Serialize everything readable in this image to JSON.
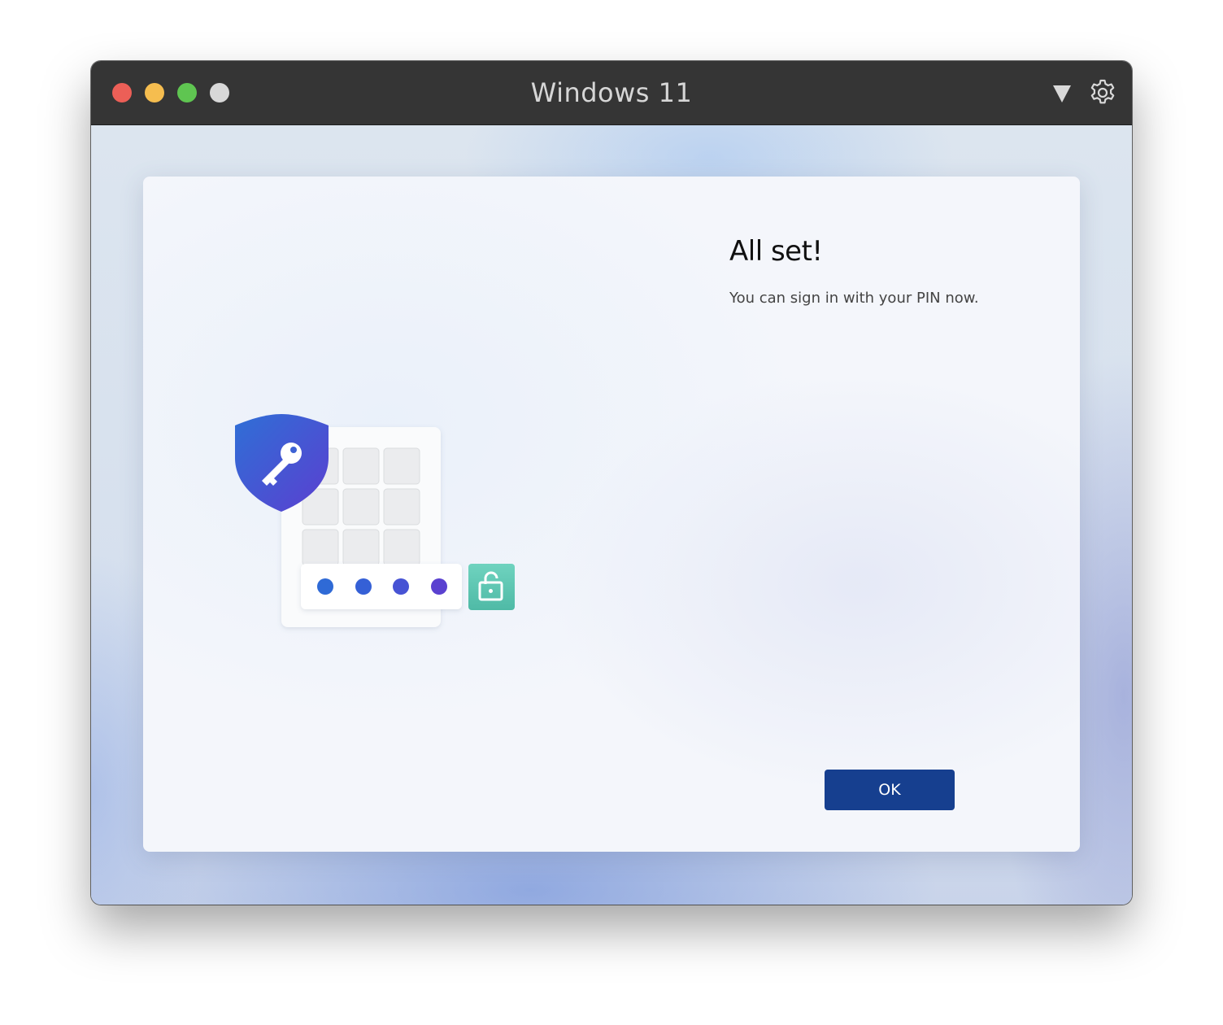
{
  "window": {
    "title": "Windows 11"
  },
  "setup": {
    "heading": "All set!",
    "message": "You can sign in with your PIN now.",
    "ok_label": "OK"
  },
  "colors": {
    "titlebar": "#353535",
    "accent_button": "#163f8f",
    "traffic_close": "#ec5f57",
    "traffic_minimize": "#f5bd4f",
    "traffic_maximize": "#5fc551",
    "shield_blue": "#2f6fd6",
    "unlock_teal": "#5cc7b2"
  },
  "icons": {
    "titlebar": [
      "dropdown-triangle-icon",
      "gear-icon"
    ],
    "bottom": [
      "accessibility-icon",
      "volume-icon"
    ],
    "illustration": [
      "shield-key-icon",
      "keypad-icon",
      "pin-dots",
      "unlock-padlock-icon"
    ]
  },
  "pin": {
    "entered_digits": 4
  }
}
